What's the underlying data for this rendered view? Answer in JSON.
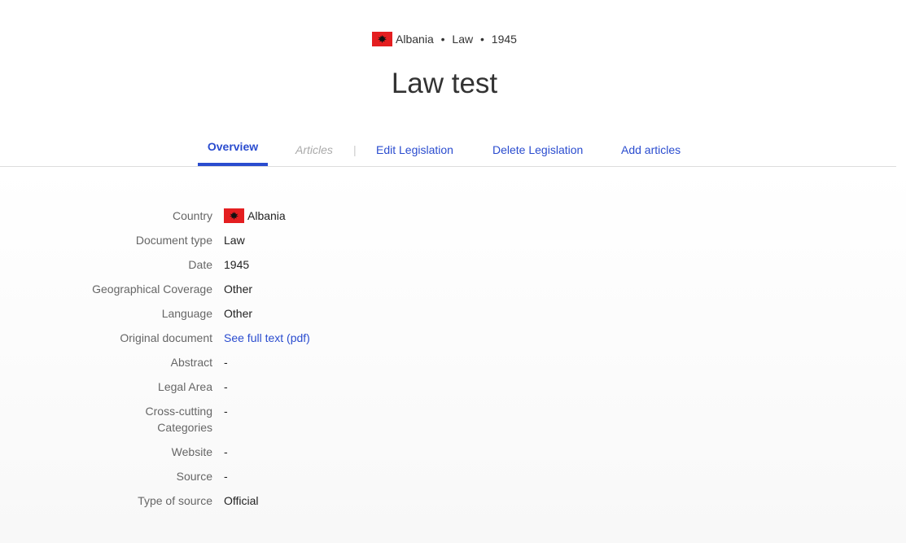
{
  "header": {
    "country": "Albania",
    "doc_type": "Law",
    "year": "1945",
    "separator": "•",
    "title": "Law test",
    "flag_color": "#e41e20",
    "flag_icon": "albania-flag-icon"
  },
  "tabs": {
    "overview": "Overview",
    "articles": "Articles",
    "divider": "|",
    "edit": "Edit Legislation",
    "delete": "Delete Legislation",
    "add": "Add articles",
    "accent": "#2a4ccf"
  },
  "details": {
    "country": {
      "label": "Country",
      "value": "Albania"
    },
    "document_type": {
      "label": "Document type",
      "value": "Law"
    },
    "date": {
      "label": "Date",
      "value": "1945"
    },
    "geo_coverage": {
      "label": "Geographical Coverage",
      "value": "Other"
    },
    "language": {
      "label": "Language",
      "value": "Other"
    },
    "original_document": {
      "label": "Original document",
      "value": "See full text (pdf)"
    },
    "abstract": {
      "label": "Abstract",
      "value": "-"
    },
    "legal_area": {
      "label": "Legal Area",
      "value": "-"
    },
    "cross_cutting": {
      "label_line1": "Cross-cutting",
      "label_line2": "Categories",
      "value": "-"
    },
    "website": {
      "label": "Website",
      "value": "-"
    },
    "source": {
      "label": "Source",
      "value": "-"
    },
    "type_of_source": {
      "label": "Type of source",
      "value": "Official"
    }
  }
}
